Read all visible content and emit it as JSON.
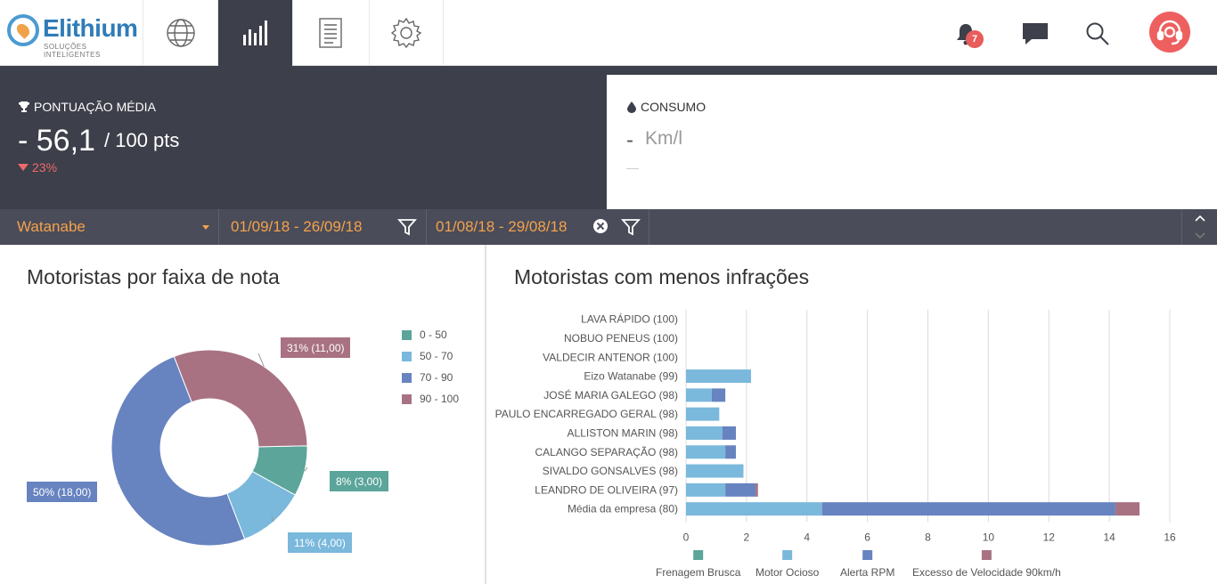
{
  "app": {
    "brand": "Elithium",
    "tagline": "SOLUÇÕES INTELIGENTES"
  },
  "nav": {
    "tabs": [
      {
        "name": "globe",
        "icon": "globe-icon"
      },
      {
        "name": "dashboard",
        "icon": "bar-chart-icon",
        "active": true
      },
      {
        "name": "reports",
        "icon": "document-icon"
      },
      {
        "name": "settings",
        "icon": "gear-icon"
      }
    ],
    "notifications_count": "7"
  },
  "kpi": {
    "score_title": "PONTUAÇÃO MÉDIA",
    "score_value": "- 56,1",
    "score_max": "/ 100 pts",
    "score_delta": "23%",
    "consumo_title": "CONSUMO",
    "consumo_value": "-",
    "consumo_unit": "Km/l",
    "consumo_sub": "—"
  },
  "filters": {
    "driver": "Watanabe",
    "period1": "01/09/18 - 26/09/18",
    "period2": "01/08/18 - 29/08/18"
  },
  "colors": {
    "r0_50": "#5ba59a",
    "r50_70": "#7ab8dc",
    "r70_90": "#6783c0",
    "r90_100": "#a87282",
    "accent": "#f4a24c",
    "dark": "#3d3f4a"
  },
  "chart_data": [
    {
      "type": "pie",
      "title": "Motoristas por faixa de nota",
      "legend_position": "top-right",
      "categories": [
        "0 - 50",
        "50 - 70",
        "70 - 90",
        "90 - 100"
      ],
      "values": [
        3,
        4,
        18,
        11
      ],
      "labels": [
        "8% (3,00)",
        "11% (4,00)",
        "50% (18,00)",
        "31% (11,00)"
      ],
      "colors": [
        "#5ba59a",
        "#7ab8dc",
        "#6783c0",
        "#a87282"
      ]
    },
    {
      "type": "bar",
      "orientation": "horizontal",
      "stacked": true,
      "title": "Motoristas com menos infrações",
      "categories": [
        "LAVA RÁPIDO (100)",
        "NOBUO PENEUS (100)",
        "VALDECIR ANTENOR (100)",
        "Eizo Watanabe (99)",
        "JOSÉ MARIA GALEGO (98)",
        "PAULO ENCARREGADO GERAL (98)",
        "ALLISTON MARIN (98)",
        "CALANGO SEPARAÇÃO (98)",
        "SIVALDO GONSALVES (98)",
        "LEANDRO DE OLIVEIRA (97)",
        "Média da empresa (80)"
      ],
      "xlim": [
        0,
        16
      ],
      "xticks": [
        "0",
        "2",
        "4",
        "6",
        "8",
        "10",
        "12",
        "14",
        "16"
      ],
      "grid": true,
      "legend_position": "bottom",
      "series": [
        {
          "name": "Frenagem Brusca",
          "color": "#5ba59a",
          "values": [
            0,
            0,
            0,
            0,
            0,
            0,
            0,
            0,
            0,
            0,
            0
          ]
        },
        {
          "name": "Motor Ocioso",
          "color": "#7ab8dc",
          "values": [
            0,
            0,
            0,
            2.15,
            0.85,
            1.1,
            1.2,
            1.3,
            1.9,
            1.3,
            4.5
          ]
        },
        {
          "name": "Alerta RPM",
          "color": "#6783c0",
          "values": [
            0,
            0,
            0,
            0,
            0.45,
            0,
            0.45,
            0.35,
            0,
            1.0,
            9.7
          ]
        },
        {
          "name": "Excesso de Velocidade 90km/h",
          "color": "#a87282",
          "values": [
            0,
            0,
            0,
            0,
            0,
            0,
            0,
            0,
            0,
            0.08,
            0.8
          ]
        }
      ]
    }
  ]
}
